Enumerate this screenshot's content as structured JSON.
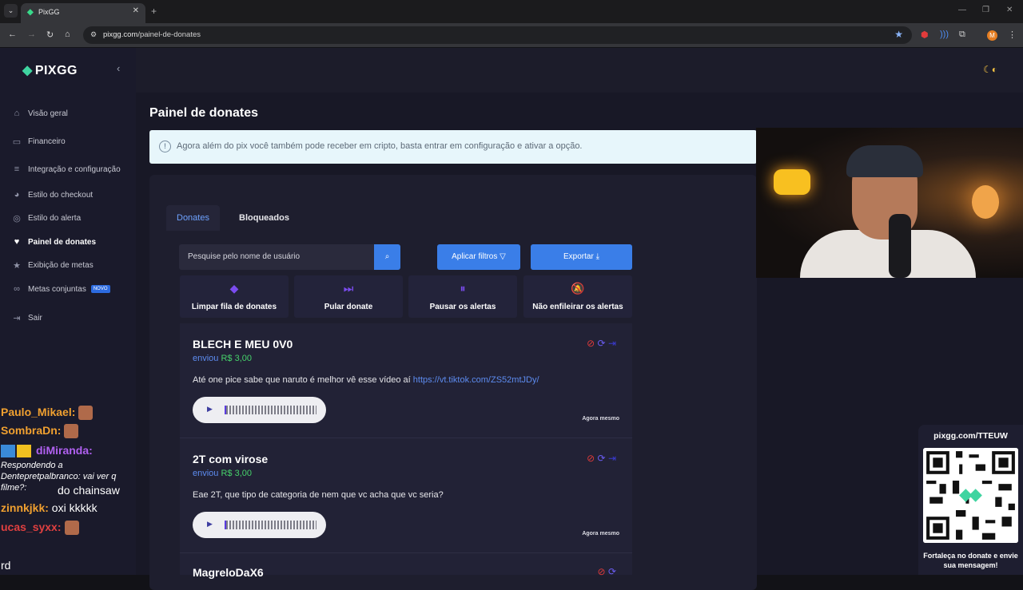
{
  "browser": {
    "tab_title": "PixGG",
    "url_domain": "pixgg.com",
    "url_path": "/painel-de-donates",
    "profile_initial": "M"
  },
  "sidebar": {
    "logo": "PIXGG",
    "items": [
      {
        "label": "Visão geral",
        "icon": "home-icon"
      },
      {
        "label": "Financeiro",
        "icon": "wallet-icon"
      },
      {
        "label": "Integração e configuração",
        "icon": "settings-icon"
      },
      {
        "label": "Estilo do checkout",
        "icon": "palette-icon"
      },
      {
        "label": "Estilo do alerta",
        "icon": "alert-icon"
      },
      {
        "label": "Painel de donates",
        "icon": "donate-icon",
        "active": true
      },
      {
        "label": "Exibição de metas",
        "icon": "star-icon"
      },
      {
        "label": "Metas conjuntas",
        "icon": "link-icon",
        "badge": "NOVO"
      },
      {
        "label": "Sair",
        "icon": "logout-icon"
      }
    ]
  },
  "page": {
    "title": "Painel de donates",
    "info": "Agora além do pix você também pode receber em cripto, basta entrar em configuração e ativar a opção."
  },
  "tabs": [
    "Donates",
    "Bloqueados"
  ],
  "toolbar": {
    "search_placeholder": "Pesquise pelo nome de usuário",
    "filters_label": "Aplicar filtros",
    "export_label": "Exportar"
  },
  "actions": [
    {
      "label": "Limpar fila de donates",
      "icon": "eraser-icon"
    },
    {
      "label": "Pular donate",
      "icon": "skip-icon"
    },
    {
      "label": "Pausar os alertas",
      "icon": "pause-icon"
    },
    {
      "label": "Não enfileirar os alertas",
      "icon": "bell-off-icon"
    }
  ],
  "donates": [
    {
      "name": "BLECH E MEU 0V0",
      "sent": "enviou",
      "amount": "R$ 3,00",
      "message": "Até one pice sabe que naruto é melhor vê esse vídeo aí ",
      "link": "https://vt.tiktok.com/ZS52mtJDy/",
      "time": "Agora mesmo"
    },
    {
      "name": "2T com virose",
      "sent": "enviou",
      "amount": "R$ 3,00",
      "message": "Eae 2T, que tipo de categoria de nem que vc acha que vc seria?",
      "link": "",
      "time": "Agora mesmo"
    },
    {
      "name": "MagreloDaX6",
      "sent": "",
      "amount": "",
      "message": "",
      "link": "",
      "time": ""
    }
  ],
  "chat": [
    {
      "user": "Paulo_Mikael:",
      "color": "#f0a030",
      "text": ""
    },
    {
      "user": "SombraDn:",
      "color": "#f0a030",
      "text": ""
    },
    {
      "user": "diMiranda:",
      "color": "#b060f0",
      "text": ""
    },
    {
      "user": "",
      "color": "#ffffff",
      "text": "Respondendo a Dentepretpalbranco: vai ver q filme?:"
    },
    {
      "user": "",
      "color": "#ffffff",
      "text": "do chainsaw"
    },
    {
      "user": "zinnkjkk:",
      "color": "#f0a030",
      "text": "oxi kkkkk"
    },
    {
      "user": "ucas_syxx:",
      "color": "#e04040",
      "text": ""
    },
    {
      "user": "",
      "color": "#ffffff",
      "text": "rd"
    }
  ],
  "overlay": {
    "qr_url": "pixgg.com/TTEUW",
    "qr_footer": "Fortaleça no donate e envie sua mensagem!"
  }
}
